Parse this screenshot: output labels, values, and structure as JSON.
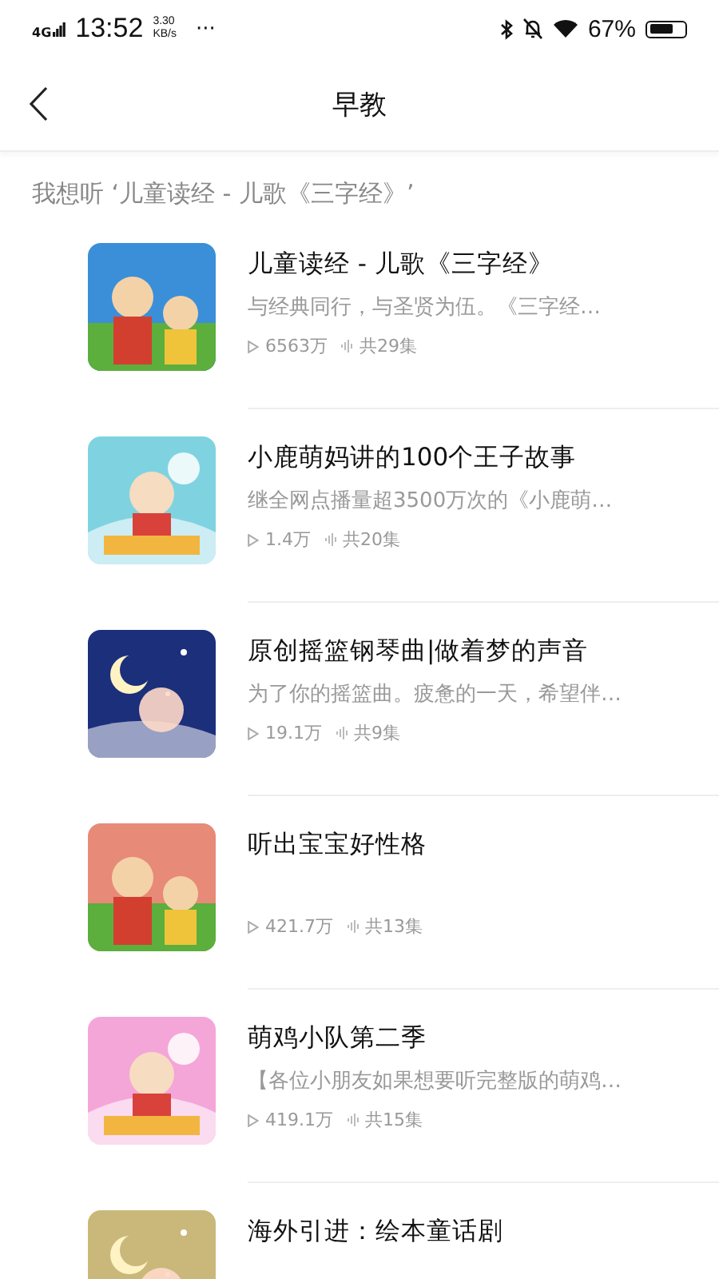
{
  "status_bar": {
    "network": "4G",
    "time": "13:52",
    "speed_value": "3.30",
    "speed_unit": "KB/s",
    "more": "···",
    "battery_text": "67%"
  },
  "nav": {
    "title": "早教"
  },
  "prompt": "我想听 ‘儿童读经 - 儿歌《三字经》’",
  "albums": [
    {
      "title": "儿童读经 - 儿歌《三字经》",
      "description": "与经典同行，与圣贤为伍。《三字经…",
      "plays": "6563万",
      "episodes": "共29集"
    },
    {
      "title": "小鹿萌妈讲的100个王子故事",
      "description": "继全网点播量超3500万次的《小鹿萌…",
      "plays": "1.4万",
      "episodes": "共20集"
    },
    {
      "title": "原创摇篮钢琴曲|做着梦的声音",
      "description": "为了你的摇篮曲。疲惫的一天，希望伴…",
      "plays": "19.1万",
      "episodes": "共9集"
    },
    {
      "title": "听出宝宝好性格",
      "plays": "421.7万",
      "episodes": "共13集"
    },
    {
      "title": "萌鸡小队第二季",
      "description": "【各位小朋友如果想要听完整版的萌鸡…",
      "plays": "419.1万",
      "episodes": "共15集"
    },
    {
      "title": "海外引进：绘本童话剧"
    }
  ]
}
